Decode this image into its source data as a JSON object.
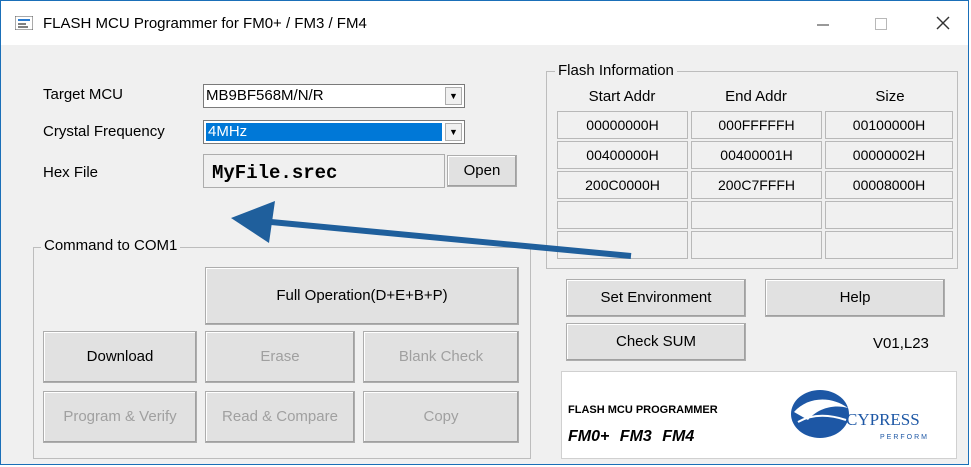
{
  "window": {
    "title": "FLASH MCU Programmer for FM0+ / FM3 / FM4",
    "minimize_icon": "minimize-icon",
    "maximize_icon": "maximize-icon",
    "close_icon": "close-icon"
  },
  "form": {
    "target_mcu_label": "Target MCU",
    "target_mcu_value": "MB9BF568M/N/R",
    "crystal_label": "Crystal Frequency",
    "crystal_value": "4MHz",
    "hex_label": "Hex File",
    "hex_value": "MyFile.srec",
    "open_button": "Open"
  },
  "flash_info": {
    "title": "Flash Information",
    "columns": [
      "Start Addr",
      "End Addr",
      "Size"
    ],
    "rows": [
      [
        "00000000H",
        "000FFFFFH",
        "00100000H"
      ],
      [
        "00400000H",
        "00400001H",
        "00000002H"
      ],
      [
        "200C0000H",
        "200C7FFFH",
        "00008000H"
      ],
      [
        "",
        "",
        ""
      ],
      [
        "",
        "",
        ""
      ]
    ]
  },
  "command": {
    "title": "Command  to  COM1",
    "full_operation": "Full Operation(D+E+B+P)",
    "download": "Download",
    "erase": "Erase",
    "blank_check": "Blank Check",
    "program_verify": "Program & Verify",
    "read_compare": "Read & Compare",
    "copy": "Copy"
  },
  "right_panel": {
    "set_environment": "Set Environment",
    "help": "Help",
    "check_sum": "Check SUM",
    "version": "V01,L23"
  },
  "logo": {
    "programmer_text": "FLASH MCU PROGRAMMER",
    "families": "FM0+ FM3 FM4",
    "brand": "CYPRESS",
    "tagline": "PERFORM"
  },
  "colors": {
    "selection": "#0078d7",
    "arrow": "#1f5f9c",
    "disabled_text": "#a0a0a0",
    "cypress_blue": "#1d57a5"
  }
}
